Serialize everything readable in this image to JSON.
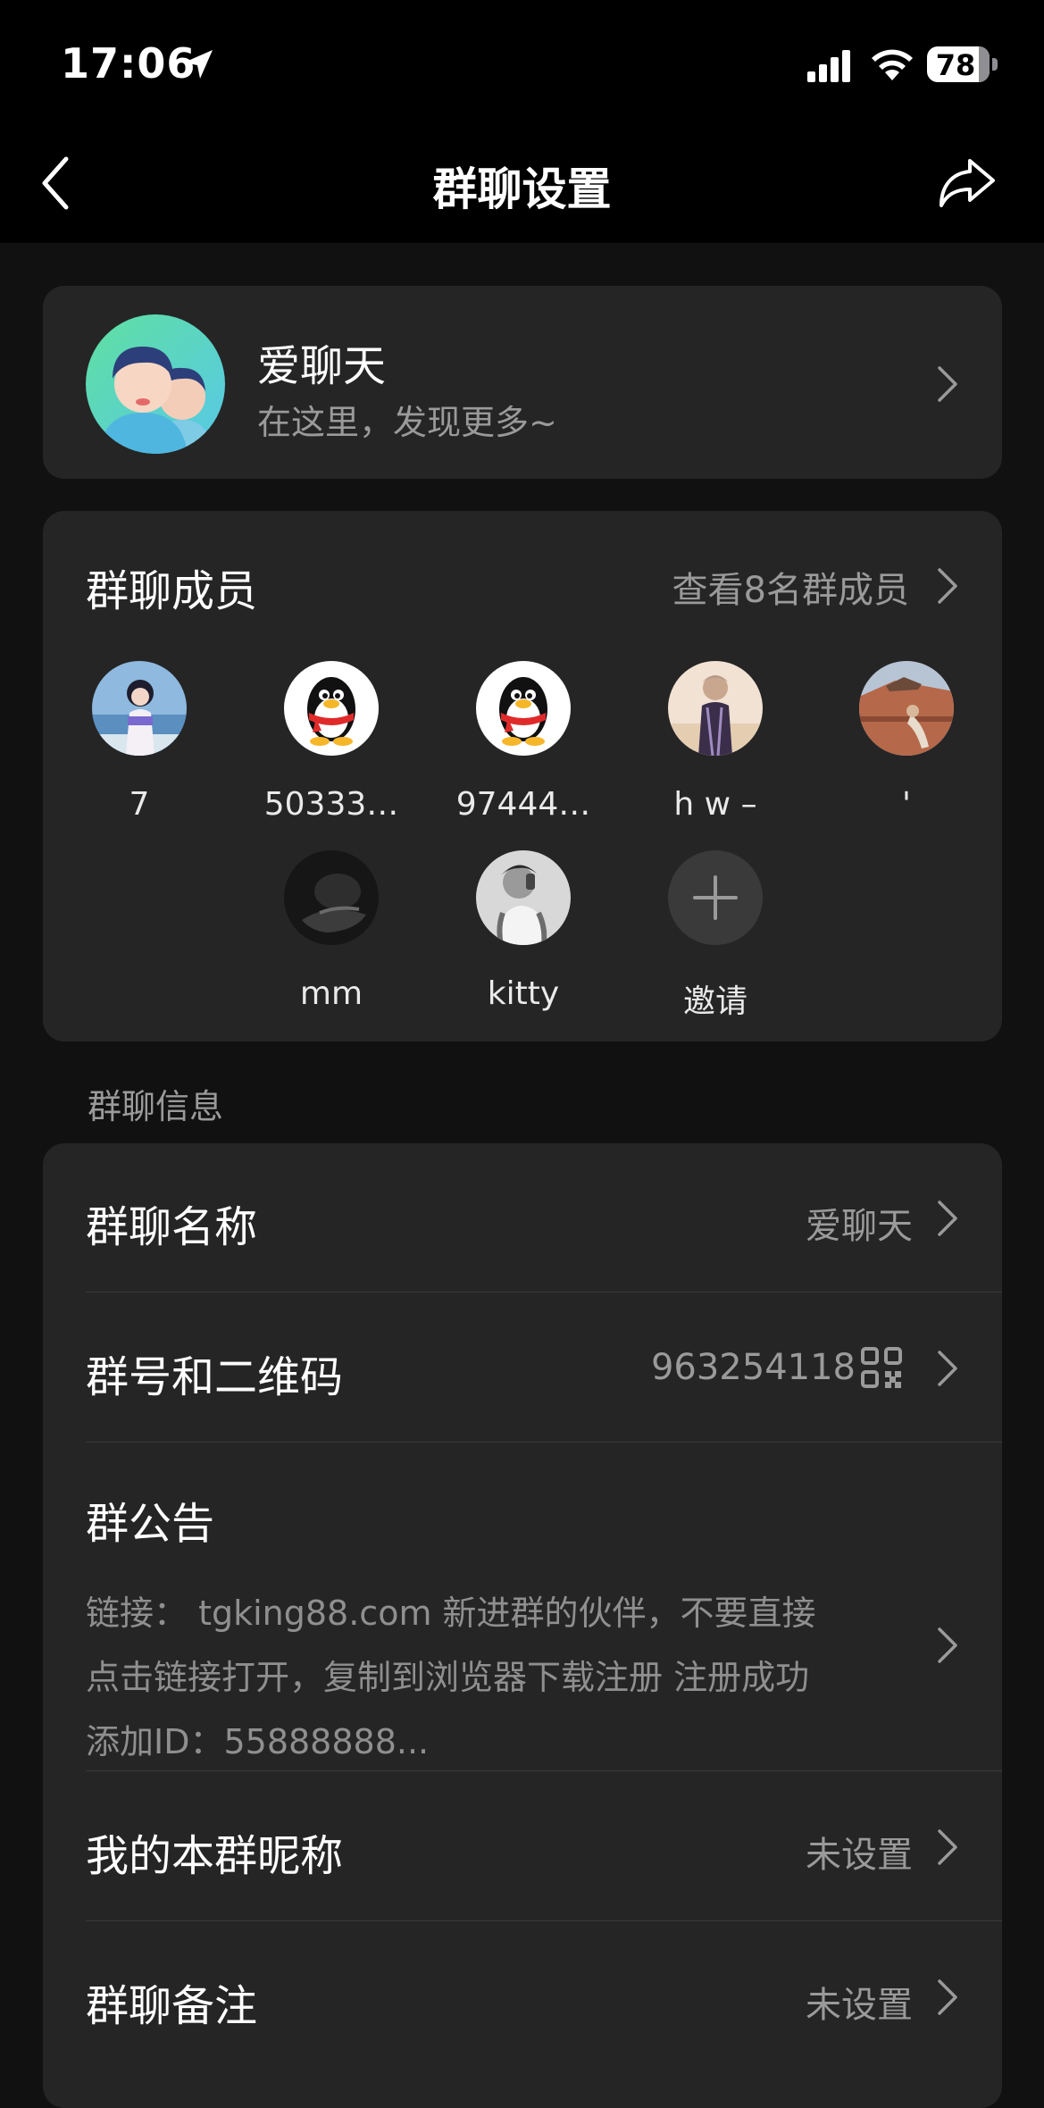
{
  "status_bar": {
    "time": "17:06",
    "battery": "78"
  },
  "nav": {
    "title": "群聊设置"
  },
  "group": {
    "name": "爱聊天",
    "subtitle": "在这里，发现更多~"
  },
  "members": {
    "heading": "群聊成员",
    "view_all": "查看8名群成员",
    "list": [
      {
        "name": "7",
        "avatar": "photo-girl-beach"
      },
      {
        "name": "50333…",
        "avatar": "qq-penguin-icon"
      },
      {
        "name": "97444…",
        "avatar": "qq-penguin-icon"
      },
      {
        "name": "h w –",
        "avatar": "photo-man-desert"
      },
      {
        "name": "'",
        "avatar": "photo-wall-scene"
      },
      {
        "name": "mm",
        "avatar": "photo-dark-cat"
      },
      {
        "name": "kitty",
        "avatar": "photo-man-selfie"
      }
    ],
    "invite_label": "邀请"
  },
  "info_section_label": "群聊信息",
  "info": {
    "group_name_label": "群聊名称",
    "group_name_value": "爱聊天",
    "group_id_label": "群号和二维码",
    "group_id_value": "963254118",
    "notice_label": "群公告",
    "notice_lines": [
      "链接： tgking88.com 新进群的伙伴，不要直接",
      "点击链接打开，复制到浏览器下载注册 注册成功",
      "添加ID：55888888..."
    ],
    "nickname_label": "我的本群昵称",
    "nickname_value": "未设置",
    "remark_label": "群聊备注",
    "remark_value": "未设置"
  },
  "colors": {
    "background": "#111111",
    "card": "#252525",
    "secondary_text": "#9a9a9a"
  }
}
